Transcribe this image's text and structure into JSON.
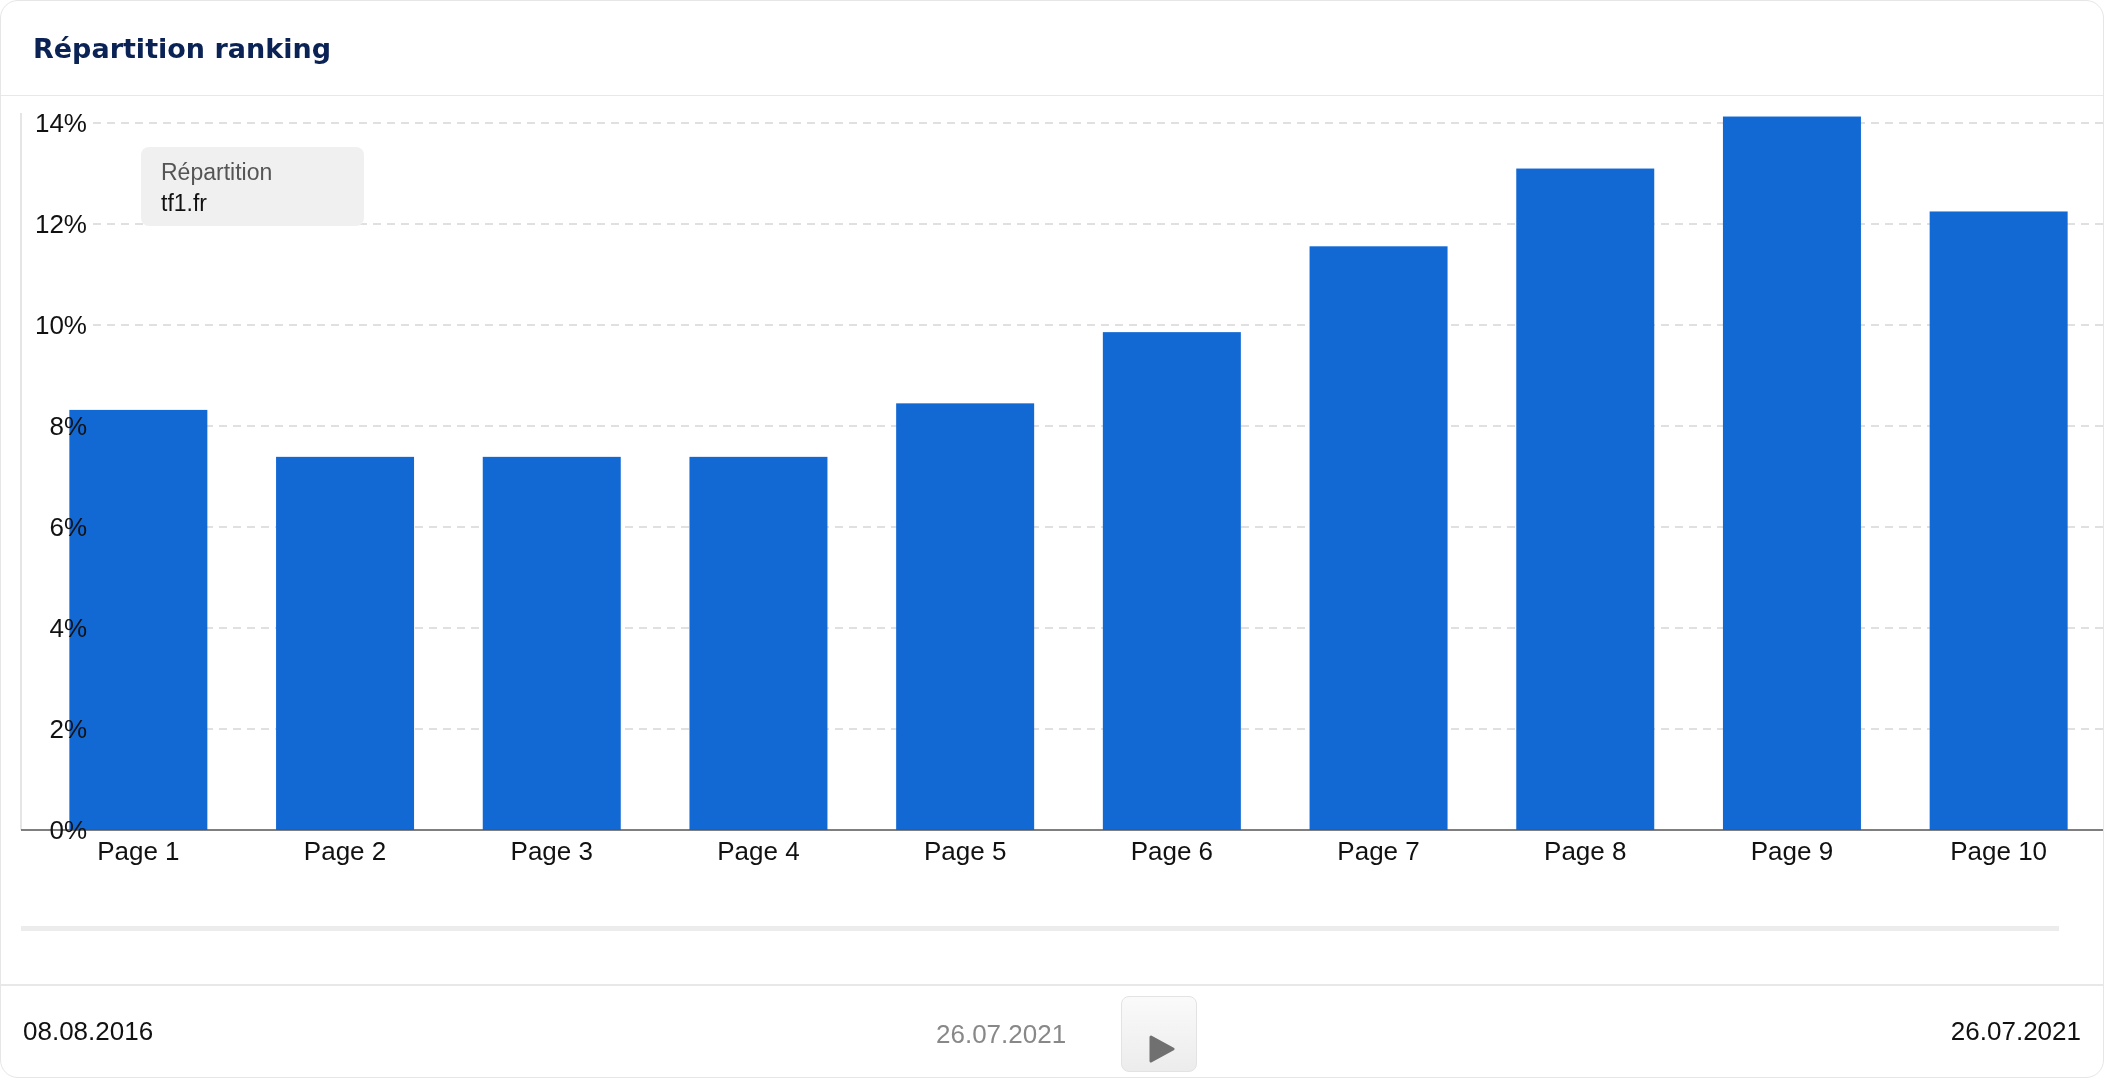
{
  "title": "Répartition ranking",
  "chart": {
    "chart_data": {
      "type": "bar",
      "categories": [
        "Page 1",
        "Page 2",
        "Page 3",
        "Page 4",
        "Page 5",
        "Page 6",
        "Page 7",
        "Page 8",
        "Page 9",
        "Page 10"
      ],
      "series": [
        {
          "name": "tf1.fr",
          "color": "#1369d4",
          "values": [
            8.32,
            7.39,
            7.39,
            7.39,
            8.45,
            9.86,
            11.56,
            13.1,
            14.13,
            12.25
          ]
        }
      ],
      "ylim": [
        0,
        14.2
      ],
      "grid": true,
      "yticks": [
        {
          "value": 0,
          "label": "0%"
        },
        {
          "value": 2,
          "label": "2%"
        },
        {
          "value": 4,
          "label": "4%"
        },
        {
          "value": 6,
          "label": "6%"
        },
        {
          "value": 8,
          "label": "8%"
        },
        {
          "value": 10,
          "label": "10%"
        },
        {
          "value": 12,
          "label": "12%"
        },
        {
          "value": 14,
          "label": "14%"
        }
      ]
    },
    "tooltip": {
      "label": "Répartition"
    }
  },
  "timeline": {
    "start": "08.08.2016",
    "current": "26.07.2021",
    "end": "26.07.2021"
  }
}
